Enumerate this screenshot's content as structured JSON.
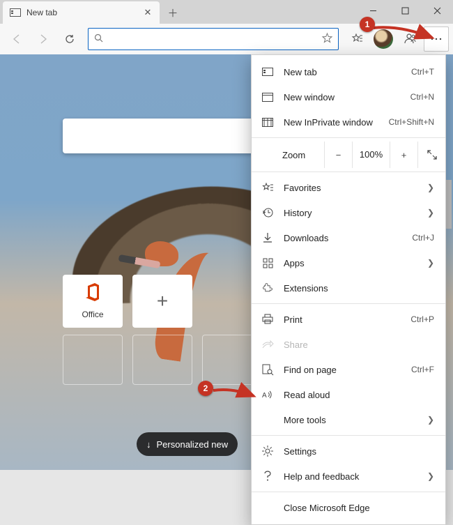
{
  "tab": {
    "title": "New tab"
  },
  "toolbar": {
    "favoritesListIcon": "favorites-list-icon"
  },
  "tiles": {
    "office": "Office"
  },
  "newsPill": "Personalized new",
  "menu": {
    "newTab": {
      "label": "New tab",
      "shortcut": "Ctrl+T"
    },
    "newWindow": {
      "label": "New window",
      "shortcut": "Ctrl+N"
    },
    "newInPrivate": {
      "label": "New InPrivate window",
      "shortcut": "Ctrl+Shift+N"
    },
    "zoom": {
      "label": "Zoom",
      "value": "100%"
    },
    "favorites": {
      "label": "Favorites"
    },
    "history": {
      "label": "History"
    },
    "downloads": {
      "label": "Downloads",
      "shortcut": "Ctrl+J"
    },
    "apps": {
      "label": "Apps"
    },
    "extensions": {
      "label": "Extensions"
    },
    "print": {
      "label": "Print",
      "shortcut": "Ctrl+P"
    },
    "share": {
      "label": "Share"
    },
    "findOnPage": {
      "label": "Find on page",
      "shortcut": "Ctrl+F"
    },
    "readAloud": {
      "label": "Read aloud"
    },
    "moreTools": {
      "label": "More tools"
    },
    "settings": {
      "label": "Settings"
    },
    "help": {
      "label": "Help and feedback"
    },
    "close": {
      "label": "Close Microsoft Edge"
    }
  },
  "annotations": {
    "step1": "1",
    "step2": "2"
  }
}
